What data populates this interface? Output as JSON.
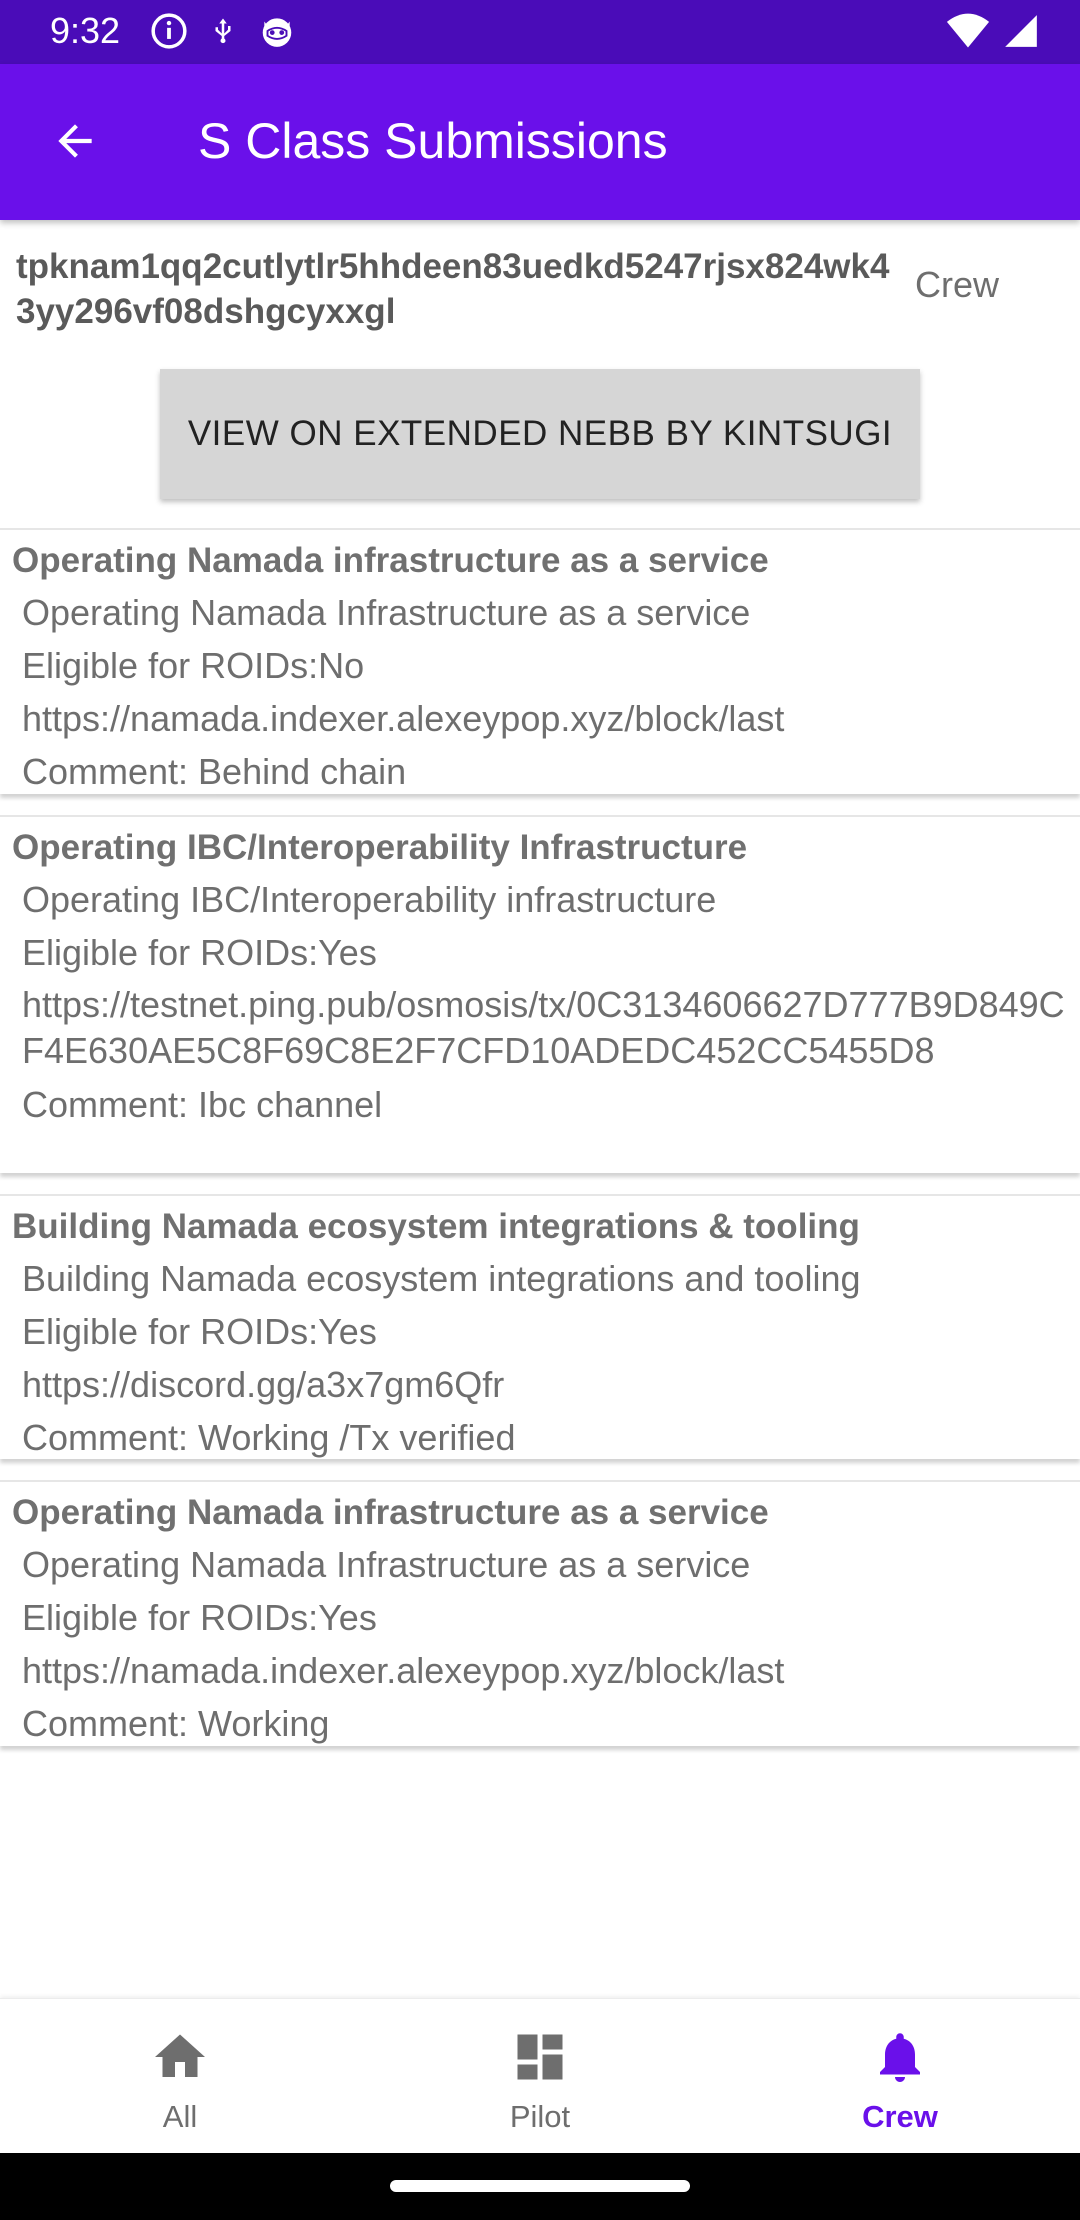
{
  "status_bar": {
    "time": "9:32",
    "left_icons": [
      "info-circle-icon",
      "usb-icon",
      "cat-icon"
    ],
    "right_icons": [
      "wifi-icon",
      "signal-icon"
    ]
  },
  "app_bar": {
    "title": "S Class Submissions",
    "back_icon": "arrow-back-icon"
  },
  "header": {
    "address": "tpknam1qq2cutlytlr5hhdeen83uedkd5247rjsx824wk43yy296vf08dshgcyxxgl",
    "role": "Crew",
    "view_button_label": "VIEW ON EXTENDED NEBB BY KINTSUGI"
  },
  "submissions": [
    {
      "title": "Operating Namada infrastructure as a service",
      "description": "Operating Namada Infrastructure as a service",
      "eligible": "Eligible for ROIDs:No",
      "link": "https://namada.indexer.alexeypop.xyz/block/last",
      "comment": "Comment: Behind chain"
    },
    {
      "title": "Operating IBC/Interoperability Infrastructure",
      "description": "Operating IBC/Interoperability infrastructure",
      "eligible": "Eligible for ROIDs:Yes",
      "link": "https://testnet.ping.pub/osmosis/tx/0C3134606627D777B9D849CF4E630AE5C8F69C8E2F7CFD10ADEDC452CC5455D8",
      "comment": "Comment: Ibc channel"
    },
    {
      "title": "Building Namada ecosystem integrations & tooling",
      "description": "Building Namada ecosystem integrations and tooling",
      "eligible": "Eligible for ROIDs:Yes",
      "link": "https://discord.gg/a3x7gm6Qfr",
      "comment": "Comment: Working /Tx verified"
    },
    {
      "title": "Operating Namada infrastructure as a service",
      "description": "Operating Namada Infrastructure as a service",
      "eligible": "Eligible for ROIDs:Yes",
      "link": "https://namada.indexer.alexeypop.xyz/block/last",
      "comment": "Comment: Working"
    }
  ],
  "bottom_nav": {
    "items": [
      {
        "label": "All",
        "icon": "home-icon",
        "active": false
      },
      {
        "label": "Pilot",
        "icon": "dashboard-icon",
        "active": false
      },
      {
        "label": "Crew",
        "icon": "bell-icon",
        "active": true
      }
    ]
  },
  "colors": {
    "status_bar": "#4a0cb8",
    "app_bar": "#6a10ea",
    "accent": "#6a10ea",
    "text_secondary": "#6e6e6e",
    "button_bg": "#d6d6d6"
  }
}
